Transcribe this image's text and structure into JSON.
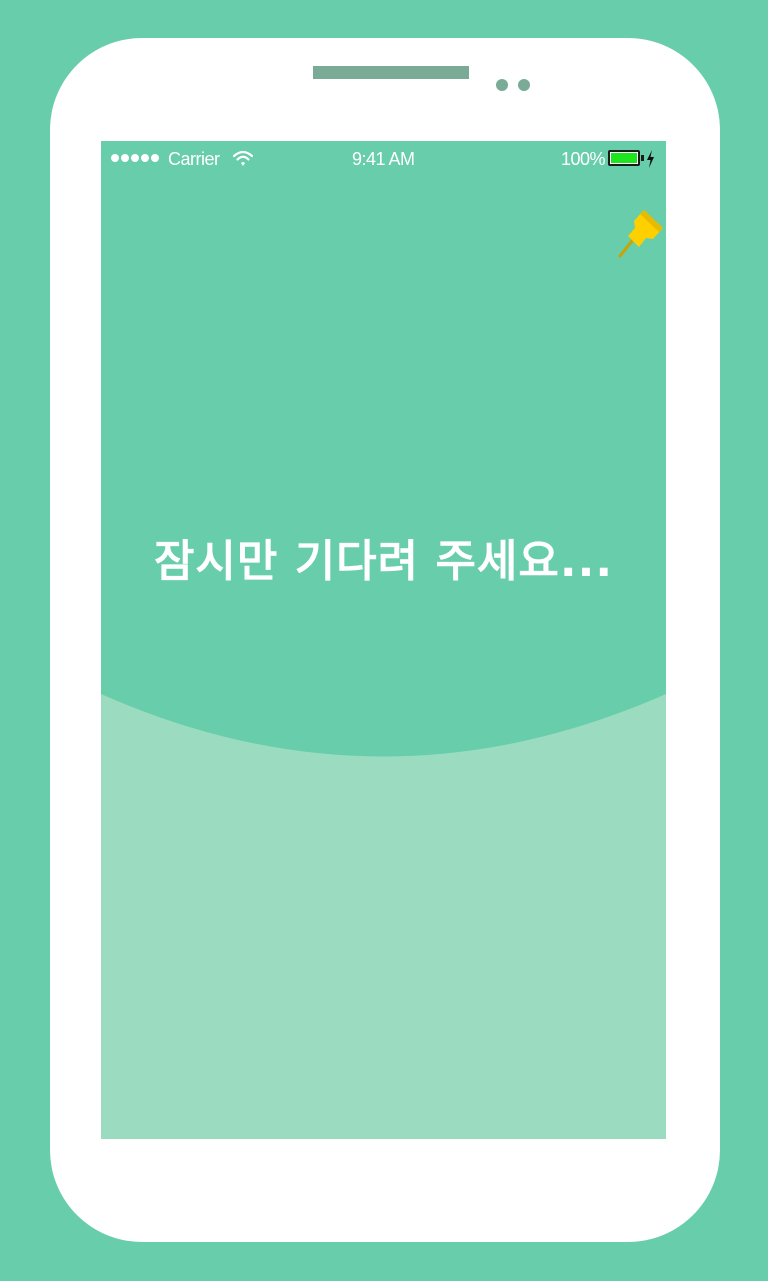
{
  "status_bar": {
    "carrier": "Carrier",
    "time": "9:41 AM",
    "battery_percent": "100%",
    "battery_level": 1.0,
    "signal_dots": 5
  },
  "main": {
    "loading_message": "잠시만 기다려 주세요..."
  },
  "icons": {
    "pin": "pushpin-icon",
    "wifi": "wifi-icon",
    "battery": "battery-icon",
    "charging": "charging-bolt-icon"
  },
  "colors": {
    "background": "#67cdab",
    "screen_top": "#67cdab",
    "screen_bottom": "#9bdcc1",
    "pin": "#ffd000",
    "battery_fill": "#1ee61e"
  }
}
